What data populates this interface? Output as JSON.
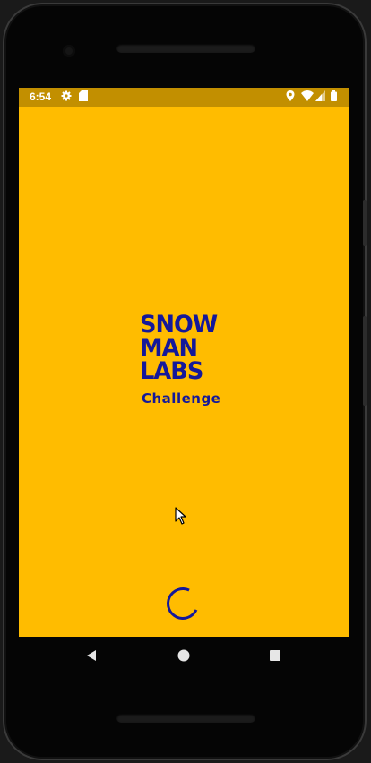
{
  "status_bar": {
    "time": "6:54",
    "icons_left": [
      "gear-icon",
      "sd-card-icon"
    ],
    "icons_right": [
      "location-icon",
      "wifi-icon",
      "signal-icon",
      "battery-icon"
    ],
    "background": "#C28F00"
  },
  "splash": {
    "background": "#FFBC00",
    "logo_lines": [
      "SNOW",
      "MAN",
      "LABS"
    ],
    "subtitle": "Challenge",
    "brand_color": "#14189A"
  },
  "loader": {
    "icon": "loading-spinner"
  },
  "nav_bar": {
    "buttons": [
      "back-icon",
      "home-icon",
      "recents-icon"
    ]
  }
}
